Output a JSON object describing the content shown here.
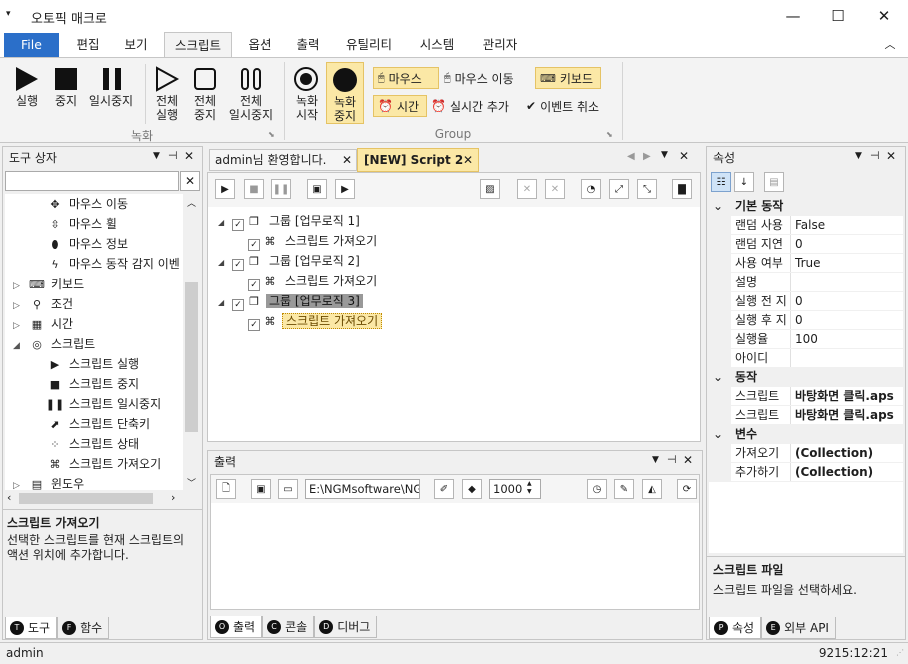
{
  "window": {
    "title": "오토픽 매크로",
    "sysmenu_glyph": "▾",
    "minimize": "—",
    "maximize": "☐",
    "close": "✕"
  },
  "menu": {
    "file": "File",
    "items": [
      "편집",
      "보기",
      "스크립트",
      "옵션",
      "출력",
      "유틸리티",
      "시스템",
      "관리자"
    ],
    "collapse": "︿"
  },
  "ribbon": {
    "record_buttons": [
      {
        "label": "실행"
      },
      {
        "label": "중지"
      },
      {
        "label": "일시중지"
      },
      {
        "label": "전체\n실행"
      },
      {
        "label": "전체\n중지"
      },
      {
        "label": "전체\n일시중지"
      }
    ],
    "group1": "녹화",
    "rec_start": "녹화\n시작",
    "rec_stop": "녹화\n중지",
    "mouse": "마우스",
    "mouse_move": "마우스 이동",
    "keyboard": "키보드",
    "time": "시간",
    "realtime_add": "실시간 추가",
    "event_cancel": "이벤트 취소",
    "group2": "Group"
  },
  "toolbox": {
    "title": "도구 상자",
    "search_placeholder": "",
    "items": [
      {
        "label": "마우스 이동",
        "indent": 2,
        "icon": "✥"
      },
      {
        "label": "마우스 휠",
        "indent": 2,
        "icon": "⇳"
      },
      {
        "label": "마우스 정보",
        "indent": 2,
        "icon": "⬮"
      },
      {
        "label": "마우스 동작 감지 이벤",
        "indent": 2,
        "icon": "ϟ"
      },
      {
        "label": "키보드",
        "indent": 1,
        "icon": "⌨",
        "expander": "▷"
      },
      {
        "label": "조건",
        "indent": 1,
        "icon": "⚲",
        "expander": "▷"
      },
      {
        "label": "시간",
        "indent": 1,
        "icon": "▦",
        "expander": "▷"
      },
      {
        "label": "스크립트",
        "indent": 1,
        "icon": "◎",
        "expander": "◢"
      },
      {
        "label": "스크립트 실행",
        "indent": 2,
        "icon": "▶"
      },
      {
        "label": "스크립트 중지",
        "indent": 2,
        "icon": "■"
      },
      {
        "label": "스크립트 일시중지",
        "indent": 2,
        "icon": "❚❚"
      },
      {
        "label": "스크립트 단축키",
        "indent": 2,
        "icon": "⬈"
      },
      {
        "label": "스크립트 상태",
        "indent": 2,
        "icon": "⁘"
      },
      {
        "label": "스크립트 가져오기",
        "indent": 2,
        "icon": "⌘"
      },
      {
        "label": "윈도우",
        "indent": 1,
        "icon": "▤",
        "expander": "▷"
      }
    ],
    "desc_title": "스크립트 가져오기",
    "desc_text": "선택한 스크립트를 현재 스크립트의 액션 위치에 추가합니다.",
    "tabs": [
      {
        "icon": "T",
        "label": "도구"
      },
      {
        "icon": "F",
        "label": "함수"
      }
    ]
  },
  "editor": {
    "tabs": [
      {
        "label": "admin님 환영합니다.",
        "close": "✕"
      },
      {
        "label": "[NEW] Script 2",
        "close": "✕"
      }
    ],
    "tree": [
      {
        "label": "그룹 [업무로직 1]",
        "level": 0,
        "selected": false
      },
      {
        "label": "스크립트 가져오기",
        "level": 1,
        "selected": false
      },
      {
        "label": "그룹 [업무로직 2]",
        "level": 0,
        "selected": false
      },
      {
        "label": "스크립트 가져오기",
        "level": 1,
        "selected": false
      },
      {
        "label": "그룹 [업무로직 3]",
        "level": 0,
        "selected": true
      },
      {
        "label": "스크립트 가져오기",
        "level": 1,
        "selected": true
      }
    ]
  },
  "output": {
    "title": "출력",
    "path": "E:\\NGMsoftware\\NG",
    "number": "1000",
    "tabs": [
      {
        "icon": "O",
        "label": "출력"
      },
      {
        "icon": "C",
        "label": "콘솔"
      },
      {
        "icon": "D",
        "label": "디버그"
      }
    ]
  },
  "properties": {
    "title": "속성",
    "sections": [
      {
        "name": "기본 동작",
        "rows": [
          {
            "key": "랜덤 사용",
            "value": "False",
            "bold": false
          },
          {
            "key": "랜덤 지연",
            "value": "0",
            "bold": false
          },
          {
            "key": "사용 여부",
            "value": "True",
            "bold": false
          },
          {
            "key": "설명",
            "value": "",
            "bold": false
          },
          {
            "key": "실행 전 지",
            "value": "0",
            "bold": false
          },
          {
            "key": "실행 후 지",
            "value": "0",
            "bold": false
          },
          {
            "key": "실행율",
            "value": "100",
            "bold": false
          },
          {
            "key": "아이디",
            "value": "",
            "bold": false
          }
        ]
      },
      {
        "name": "동작",
        "rows": [
          {
            "key": "스크립트",
            "value": "바탕화면 클릭.aps",
            "bold": true
          },
          {
            "key": "스크립트",
            "value": "바탕화면 클릭.aps",
            "bold": true
          }
        ]
      },
      {
        "name": "변수",
        "rows": [
          {
            "key": "가져오기",
            "value": "(Collection)",
            "bold": true
          },
          {
            "key": "추가하기",
            "value": "(Collection)",
            "bold": true
          }
        ]
      }
    ],
    "desc_title": "스크립트 파일",
    "desc_text": "스크립트 파일을 선택하세요.",
    "tabs": [
      {
        "icon": "P",
        "label": "속성"
      },
      {
        "icon": "E",
        "label": "외부 API"
      }
    ]
  },
  "status": {
    "user": "admin",
    "time": "9215:12:21"
  }
}
